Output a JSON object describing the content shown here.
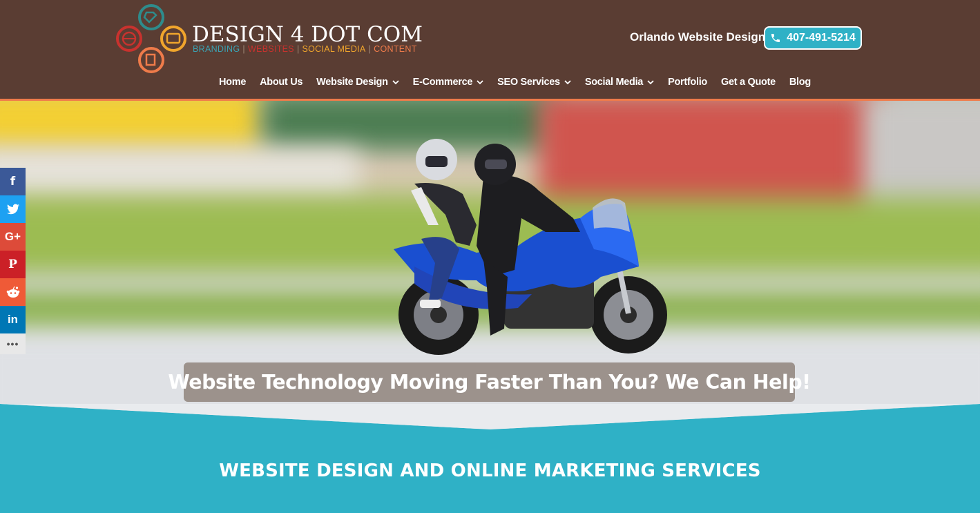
{
  "logo": {
    "title": "DESIGN 4 DOT COM",
    "tags": [
      "BRANDING",
      "WEBSITES",
      "SOCIAL MEDIA",
      "CONTENT"
    ],
    "colors": {
      "teal": "#2e8c8c",
      "red": "#c8322e",
      "yellow": "#f0a52c",
      "orange": "#ef7b4a"
    }
  },
  "header": {
    "tagline": "Orlando Website Design",
    "phone": "407-491-5214",
    "background": "#5a3d33",
    "accent": "#2fb1c6"
  },
  "nav": [
    {
      "label": "Home",
      "dropdown": false
    },
    {
      "label": "About Us",
      "dropdown": false
    },
    {
      "label": "Website Design",
      "dropdown": true
    },
    {
      "label": "E-Commerce",
      "dropdown": true
    },
    {
      "label": "SEO Services",
      "dropdown": true
    },
    {
      "label": "Social Media",
      "dropdown": true
    },
    {
      "label": "Portfolio",
      "dropdown": false
    },
    {
      "label": "Get a Quote",
      "dropdown": false
    },
    {
      "label": "Blog",
      "dropdown": false
    }
  ],
  "hero": {
    "caption": "Website Technology Moving Faster Than You? We Can Help!"
  },
  "section": {
    "title": "WEBSITE DESIGN AND ONLINE MARKETING SERVICES"
  },
  "share": [
    {
      "glyph": "f",
      "icon": "facebook-icon",
      "color": "#3b5998"
    },
    {
      "glyph": "",
      "icon": "twitter-icon",
      "color": "#1da1f2"
    },
    {
      "glyph": "G+",
      "icon": "google-plus-icon",
      "color": "#dd4b39"
    },
    {
      "glyph": "P",
      "icon": "pinterest-icon",
      "color": "#cb2027"
    },
    {
      "glyph": "",
      "icon": "reddit-icon",
      "color": "#ef5a37"
    },
    {
      "glyph": "in",
      "icon": "linkedin-icon",
      "color": "#0077b5"
    },
    {
      "glyph": "•••",
      "icon": "more-icon",
      "color": "#e8e8e8"
    }
  ]
}
